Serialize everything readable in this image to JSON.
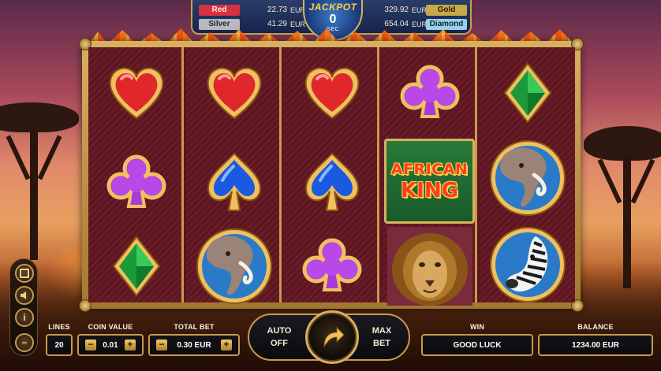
{
  "jackpot": {
    "title": "JACKPOT",
    "counter": "0",
    "unit": "SEC",
    "tiers": [
      {
        "name": "Red",
        "value": "22.73",
        "currency": "EUR",
        "color": "#d83040"
      },
      {
        "name": "Silver",
        "value": "41.29",
        "currency": "EUR",
        "color": "#b8b8c0"
      },
      {
        "name": "Gold",
        "value": "329.92",
        "currency": "EUR",
        "color": "#c8a848"
      },
      {
        "name": "Diamond",
        "value": "654.04",
        "currency": "EUR",
        "color": "#9ad0ea"
      }
    ]
  },
  "reels": {
    "wild": {
      "line1": "AFRICAN",
      "line2": "KING"
    },
    "symbols": [
      [
        "heart-symbol",
        "club-symbol",
        "diamond-symbol"
      ],
      [
        "heart-symbol",
        "spade-symbol",
        "elephant-symbol"
      ],
      [
        "heart-symbol",
        "spade-symbol",
        "club-symbol"
      ],
      [
        "club-symbol",
        "african-king-wild",
        "lion-symbol"
      ],
      [
        "diamond-symbol",
        "elephant-symbol",
        "zebra-symbol"
      ]
    ]
  },
  "controls": {
    "lines_label": "LINES",
    "lines_value": "20",
    "coin_label": "COIN VALUE",
    "coin_value": "0.01",
    "total_bet_label": "TOTAL BET",
    "total_bet_value": "0.30 EUR",
    "minus": "−",
    "plus": "+",
    "auto_line1": "AUTO",
    "auto_line2": "OFF",
    "max_line1": "MAX",
    "max_line2": "BET",
    "win_label": "WIN",
    "win_value": "GOOD LUCK",
    "balance_label": "BALANCE",
    "balance_value": "1234.00 EUR"
  },
  "side_menu": {
    "icons": [
      "fullscreen-icon",
      "sound-icon",
      "info-icon",
      "minus-icon"
    ],
    "info_glyph": "i",
    "minus_glyph": "−"
  },
  "colors": {
    "gold": "#d8b060",
    "reel_bg": "#5a1620"
  }
}
